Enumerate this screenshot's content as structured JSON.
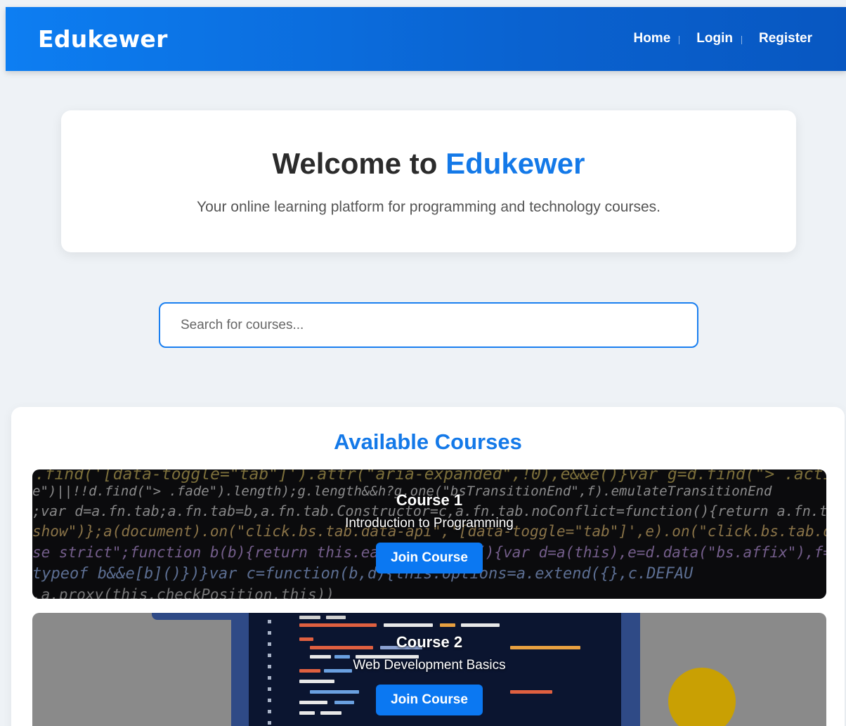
{
  "header": {
    "logo": "Edukewer",
    "nav": [
      {
        "label": "Home"
      },
      {
        "label": "Login"
      },
      {
        "label": "Register"
      }
    ]
  },
  "welcome": {
    "title_prefix": "Welcome to ",
    "title_brand": "Edukewer",
    "subtitle": "Your online learning platform for programming and technology courses."
  },
  "search": {
    "placeholder": "Search for courses..."
  },
  "courses": {
    "heading": "Available Courses",
    "items": [
      {
        "title": "Course 1",
        "description": "Introduction to Programming",
        "button": "Join Course"
      },
      {
        "title": "Course 2",
        "description": "Web Development Basics",
        "button": "Join Course"
      }
    ]
  },
  "colors": {
    "brand_blue": "#1479e8",
    "header_gradient_start": "#0d7ef2",
    "header_gradient_end": "#0857c1",
    "button_blue": "#0b78f2"
  }
}
